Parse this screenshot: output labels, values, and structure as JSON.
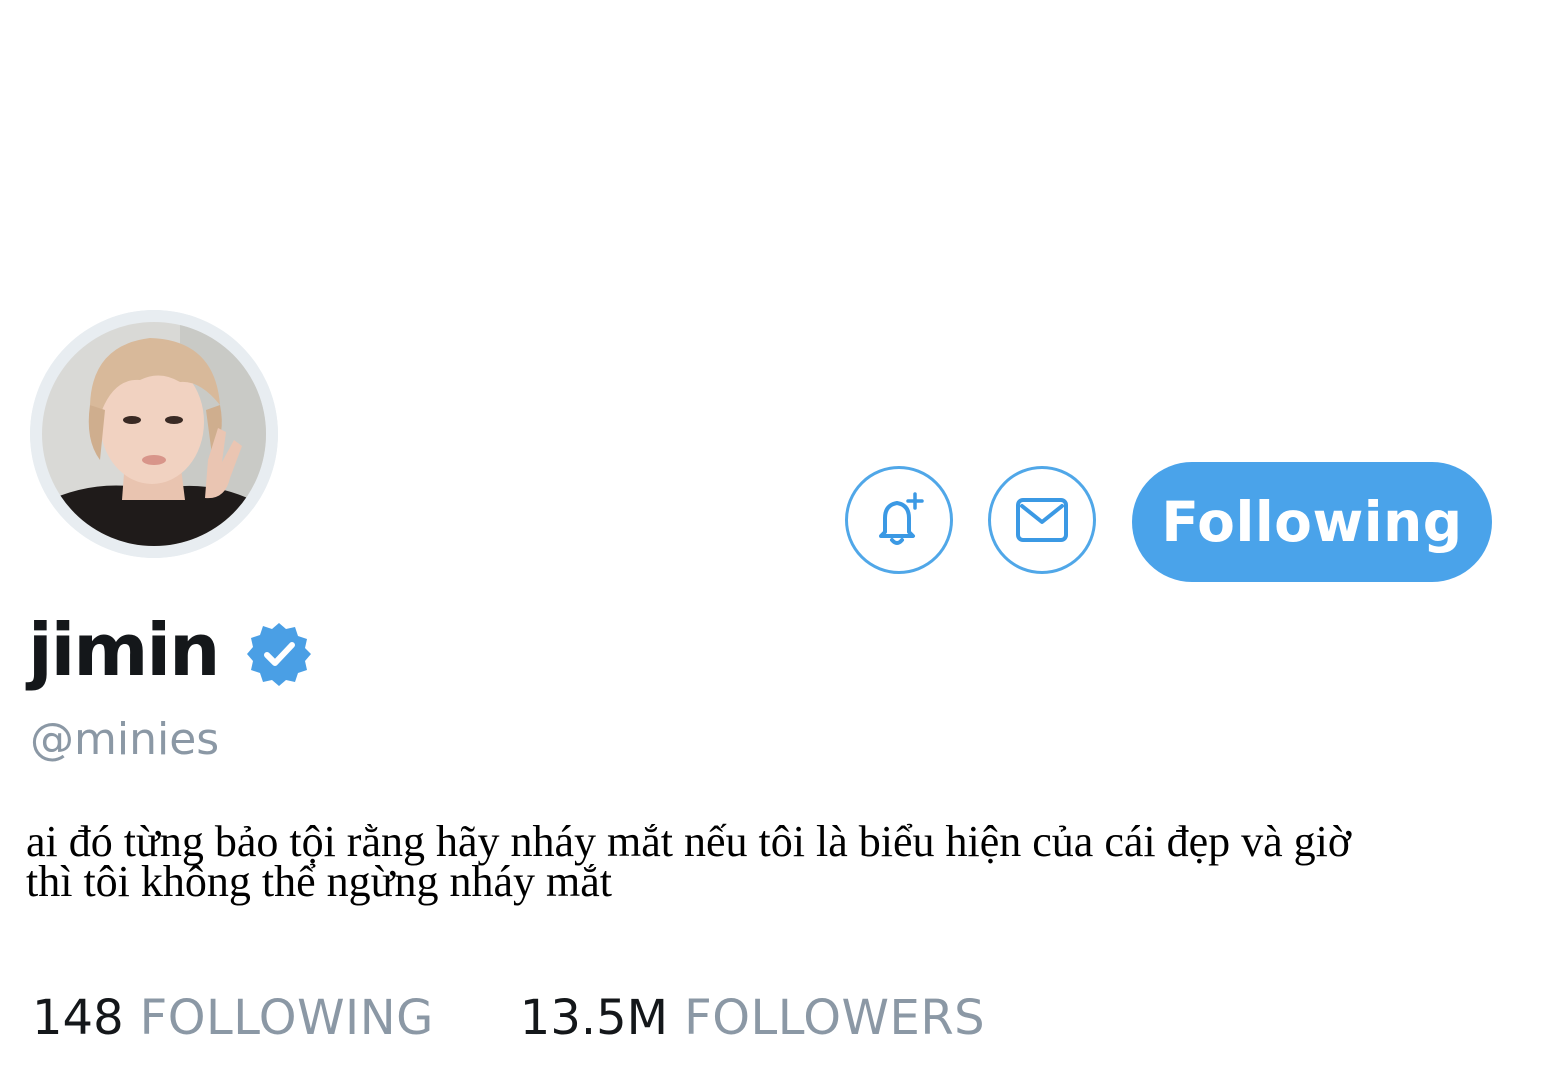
{
  "profile": {
    "display_name": "jimin",
    "handle": "@minies",
    "verified": true,
    "bio_line1": "ai đó từng bảo tội rằng hãy nháy mắt nếu tôi là biểu hiện của cái đẹp và giờ",
    "bio_line2": "thì tôi không thể ngừng nháy mắt"
  },
  "actions": {
    "notify_icon": "bell-plus-icon",
    "message_icon": "envelope-icon",
    "follow_button_label": "Following"
  },
  "stats": {
    "following_count": "148",
    "following_label": "FOLLOWING",
    "followers_count": "13.5M",
    "followers_label": "FOLLOWERS"
  },
  "colors": {
    "accent": "#4aa3ea",
    "outline": "#50a7e8",
    "muted_text": "#8b98a5",
    "primary_text": "#14171a",
    "verified_badge": "#4a9fe5"
  }
}
